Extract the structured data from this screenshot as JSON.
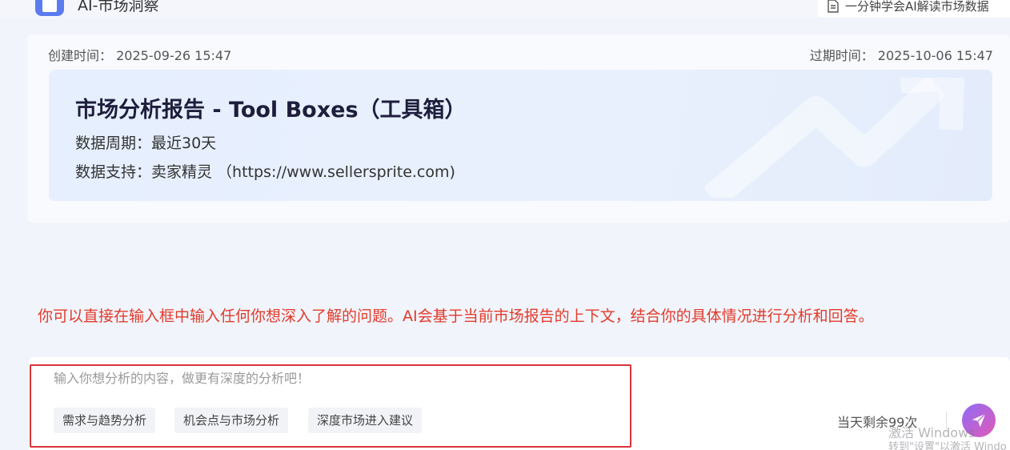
{
  "app": {
    "title": "AI-市场洞察",
    "logo_icon": "chart-icon"
  },
  "header": {
    "guide_link": "一分钟学会AI解读市场数据"
  },
  "report": {
    "created": "创建时间： 2025-09-26 15:47",
    "expires": "过期时间： 2025-10-06 15:47",
    "title": "市场分析报告 - Tool Boxes（工具箱）",
    "period": "数据周期：最近30天",
    "source": "数据支持：卖家精灵 （https://www.sellersprite.com)"
  },
  "hint": "你可以直接在输入框中输入任何你想深入了解的问题。AI会基于当前市场报告的上下文，结合你的具体情况进行分析和回答。",
  "chat_input": {
    "placeholder": "输入你想分析的内容，做更有深度的分析吧！",
    "value": "",
    "suggestions": [
      "需求与趋势分析",
      "机会点与市场分析",
      "深度市场进入建议"
    ],
    "remaining": "当天剩余99次",
    "send_icon": "send-icon"
  },
  "watermark": {
    "line1": "激活 Windows",
    "line2": "转到\"设置\"以激活 Windo"
  },
  "colors": {
    "hint": "#e23b2b",
    "highlight_border": "#d9343a",
    "send_gradient_start": "#8e6cf5",
    "send_gradient_end": "#e25ab8"
  }
}
